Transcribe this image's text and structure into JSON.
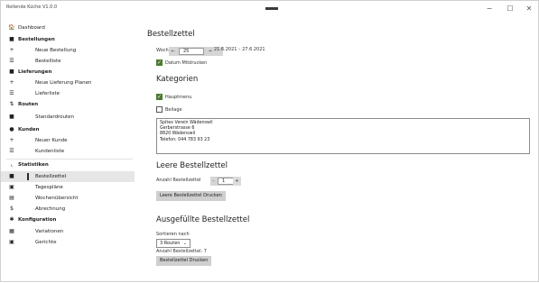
{
  "app": {
    "title": "Rollende Küche V1.0.0",
    "window_controls": {
      "minimize": "−",
      "maximize": "☐",
      "close": "✕"
    }
  },
  "sidebar": {
    "items": [
      {
        "label": "Dashboard",
        "icon": "home-icon",
        "glyph": "🏠"
      },
      {
        "label": "Bestellungen",
        "icon": "folder-icon",
        "glyph": "■"
      },
      {
        "label": "Neue Bestellung",
        "icon": "plus-icon",
        "glyph": "+"
      },
      {
        "label": "Bestelliste",
        "icon": "list-icon",
        "glyph": "☰"
      },
      {
        "label": "Lieferungen",
        "icon": "truck-icon",
        "glyph": "■"
      },
      {
        "label": "Neue Lieferung Planen",
        "icon": "plus-icon",
        "glyph": "+"
      },
      {
        "label": "Lieferliste",
        "icon": "list-icon",
        "glyph": "☰"
      },
      {
        "label": "Routen",
        "icon": "route-icon",
        "glyph": "⇅"
      },
      {
        "label": "Standardrouten",
        "icon": "document-icon",
        "glyph": "■"
      },
      {
        "label": "Kunden",
        "icon": "person-icon",
        "glyph": "●"
      },
      {
        "label": "Neuer Kunde",
        "icon": "plus-icon",
        "glyph": "+"
      },
      {
        "label": "Kundenliste",
        "icon": "list-icon",
        "glyph": "☰"
      },
      {
        "label": "Statistiken",
        "icon": "chart-icon",
        "glyph": "⌞"
      },
      {
        "label": "Bestellzettel",
        "icon": "document-icon",
        "glyph": "■"
      },
      {
        "label": "Tagespläne",
        "icon": "calendar-icon",
        "glyph": "▣"
      },
      {
        "label": "Wochenübersicht",
        "icon": "calendar-icon",
        "glyph": "▤"
      },
      {
        "label": "Abrechnung",
        "icon": "dollar-icon",
        "glyph": "$"
      },
      {
        "label": "Konfiguration",
        "icon": "gear-icon",
        "glyph": "✱"
      },
      {
        "label": "Variationen",
        "icon": "grid-icon",
        "glyph": "▦"
      },
      {
        "label": "Gerichte",
        "icon": "dish-icon",
        "glyph": "▣"
      }
    ]
  },
  "main": {
    "heading": "Bestellzettel",
    "week_label": "Woche",
    "week_value": "25",
    "week_dec": "←",
    "week_inc": "→",
    "week_range": "21.6.2021 – 27.6.2021",
    "datum_label": "Datum Mitdrucken",
    "datum_checked": true,
    "categories_heading": "Kategorien",
    "category_main": "Hauptmenu",
    "category_main_checked": true,
    "category_side": "Beilage",
    "category_side_checked": false,
    "address_lines": [
      "Spitex Verein Wädenswil",
      "Gerberstrasse 6",
      "8820 Wädenswil",
      "Telefon: 044 783 93 23"
    ],
    "empty_heading": "Leere Bestellzettel",
    "empty_count_label": "Anzahl Bestellzettel",
    "empty_count_value": "1",
    "empty_dec": "-",
    "empty_inc": "+",
    "empty_print_button": "Leere Bestellzettel Drucken",
    "filled_heading": "Ausgefüllte Bestellzettel",
    "sort_label": "Sortieren nach",
    "sort_value": "3 Routen",
    "filled_count_label": "Anzahl Bestellzettel: 7",
    "filled_print_button": "Bestellzettel Drucken"
  }
}
